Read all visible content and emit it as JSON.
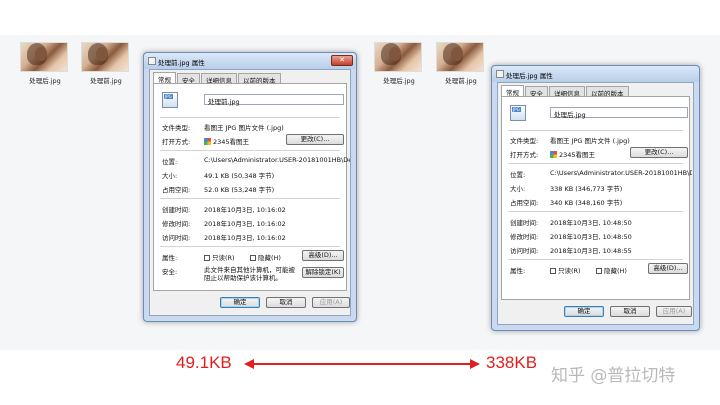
{
  "thumbnails": {
    "left_after": "处理后.jpg",
    "left_before": "处理前.jpg",
    "right_after": "处理后.jpg",
    "right_before": "处理前.jpg"
  },
  "tabs": [
    "常规",
    "安全",
    "详细信息",
    "以前的版本"
  ],
  "labels": {
    "type": "文件类型:",
    "open_with": "打开方式:",
    "location": "位置:",
    "size": "大小:",
    "size_on_disk": "占用空间:",
    "created": "创建时间:",
    "modified": "修改时间:",
    "accessed": "访问时间:",
    "attributes": "属性:",
    "security": "安全:"
  },
  "buttons": {
    "change": "更改(C)...",
    "advanced": "高级(D)...",
    "unblock": "解除锁定(K)",
    "ok": "确定",
    "cancel": "取消",
    "apply": "应用(A)"
  },
  "checkboxes": {
    "readonly": "只读(R)",
    "hidden": "隐藏(H)"
  },
  "dialog_before": {
    "title": "处理前.jpg 属性",
    "filename": "处理前.jpg",
    "type": "看图王 JPG 图片文件 (.jpg)",
    "open_with": "2345看图王",
    "location": "C:\\Users\\Administrator.USER-20181001HB\\De",
    "size": "49.1 KB (50,348 字节)",
    "size_on_disk": "52.0 KB (53,248 字节)",
    "created": "2018年10月3日, 10:16:02",
    "modified": "2018年10月3日, 10:16:02",
    "accessed": "2018年10月3日, 10:16:02",
    "security_text": "此文件来自其他计算机，可能被阻止以帮助保护该计算机。"
  },
  "dialog_after": {
    "title": "处理后.jpg 属性",
    "filename": "处理后.jpg",
    "type": "看图王 JPG 图片文件 (.jpg)",
    "open_with": "2345看图王",
    "location": "C:\\Users\\Administrator.USER-20181001HB\\De",
    "size": "338 KB (346,773 字节)",
    "size_on_disk": "340 KB (348,160 字节)",
    "created": "2018年10月3日, 10:48:50",
    "modified": "2018年10月3日, 10:48:50",
    "accessed": "2018年10月3日, 10:48:55"
  },
  "comparison": {
    "left_size": "49.1KB",
    "right_size": "338KB",
    "arrow_color": "#e02020"
  },
  "watermark": "知乎 @普拉切特"
}
